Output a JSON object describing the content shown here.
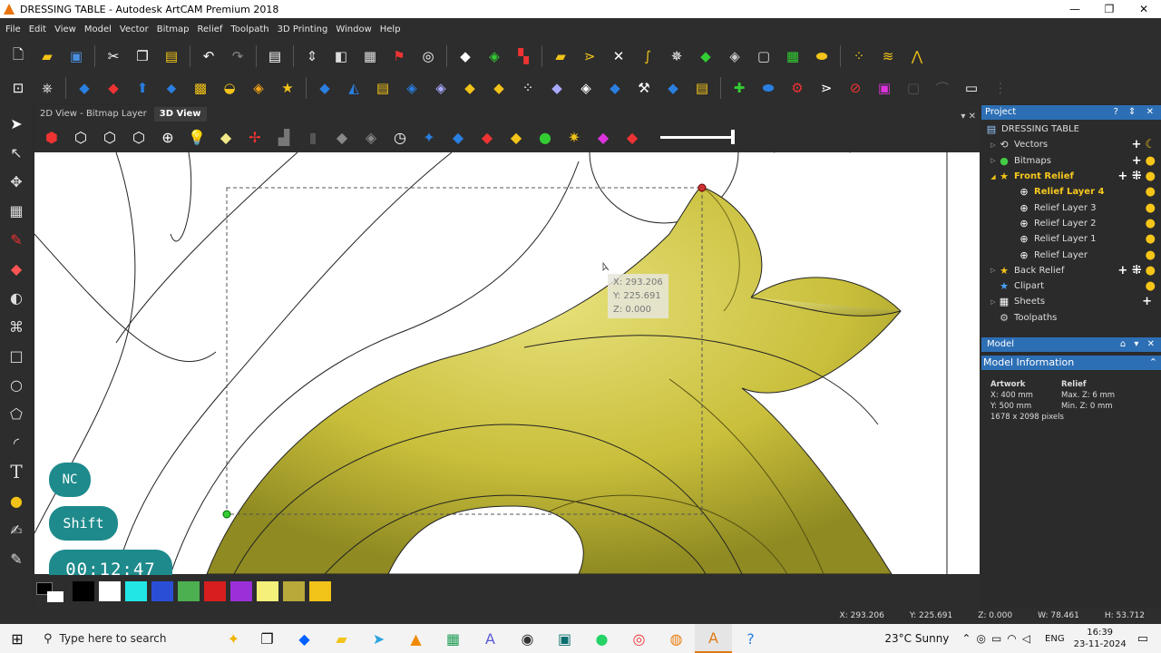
{
  "window": {
    "title": "DRESSING TABLE - Autodesk ArtCAM Premium 2018"
  },
  "menu": [
    "File",
    "Edit",
    "View",
    "Model",
    "Vector",
    "Bitmap",
    "Relief",
    "Toolpath",
    "3D Printing",
    "Window",
    "Help"
  ],
  "tabs": {
    "bitmap": "2D View - Bitmap Layer",
    "view3d": "3D View",
    "controls": "▾ ✕"
  },
  "tooltip": {
    "x": "X: 293.206",
    "y": "Y: 225.691",
    "z": "Z: 0.000"
  },
  "overlay": {
    "nc": "NC",
    "shift": "Shift",
    "timer": "00:12:47"
  },
  "palette": {
    "colors": [
      "#000000",
      "#ffffff",
      "#22e6e6",
      "#2a4fd6",
      "#4caf50",
      "#d81e1e",
      "#9b30d9",
      "#f5f07a",
      "#b8a93a",
      "#f2c318"
    ]
  },
  "status": {
    "x": "X: 293.206",
    "y": "Y: 225.691",
    "z": "Z: 0.000",
    "w": "W: 78.461",
    "h": "H: 53.712"
  },
  "project": {
    "header": "Project",
    "header_controls": "? ⇕ ✕",
    "items": [
      {
        "label": "DRESSING TABLE",
        "exp": "",
        "icon": ""
      },
      {
        "label": "Vectors",
        "exp": "▷",
        "icon": "⟲"
      },
      {
        "label": "Bitmaps",
        "exp": "▷",
        "icon": "●"
      },
      {
        "label": "Front Relief",
        "exp": "◢",
        "icon": "★"
      },
      {
        "label": "Relief Layer 4",
        "exp": "",
        "icon": "⊕"
      },
      {
        "label": "Relief Layer 3",
        "exp": "",
        "icon": "⊕"
      },
      {
        "label": "Relief Layer 2",
        "exp": "",
        "icon": "⊕"
      },
      {
        "label": "Relief Layer 1",
        "exp": "",
        "icon": "⊕"
      },
      {
        "label": "Relief Layer",
        "exp": "",
        "icon": "⊕"
      },
      {
        "label": "Back Relief",
        "exp": "▷",
        "icon": "★"
      },
      {
        "label": "Clipart",
        "exp": "",
        "icon": "★"
      },
      {
        "label": "Sheets",
        "exp": "▷",
        "icon": "▦"
      },
      {
        "label": "Toolpaths",
        "exp": "",
        "icon": "⚙"
      }
    ]
  },
  "model": {
    "header": "Model",
    "header_controls": "⌂ ▾ ✕",
    "info_title": "Model Information",
    "info_control": "⌃",
    "artwork": {
      "title": "Artwork",
      "x": "X: 400 mm",
      "y": "Y: 500 mm",
      "px": "1678 x 2098 pixels"
    },
    "relief": {
      "title": "Relief",
      "max": "Max. Z: 6 mm",
      "min": "Min. Z: 0 mm"
    }
  },
  "taskbar": {
    "search_placeholder": "Type here to search",
    "weather": "23°C  Sunny",
    "lang": "ENG",
    "time": "16:39",
    "date": "23-11-2024"
  }
}
